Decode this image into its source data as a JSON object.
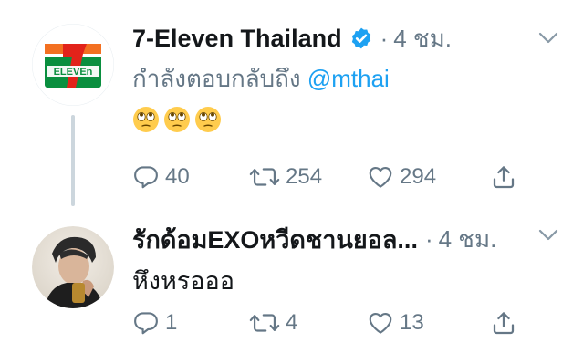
{
  "tweets": [
    {
      "display_name": "7-Eleven Thailand",
      "verified": true,
      "time": "4 ชม.",
      "reply_prefix": "กำลังตอบกลับถึง",
      "reply_to": "@mthai",
      "text": "",
      "emojis": [
        "face-with-rolling-eyes",
        "face-with-rolling-eyes",
        "face-with-rolling-eyes"
      ],
      "reply_count": "40",
      "retweet_count": "254",
      "like_count": "294",
      "avatar": "7-eleven-logo",
      "logo_text": "ELEVEn",
      "logo_number": "7"
    },
    {
      "display_name": "รักด้อมEXOหวีดชานยอล...",
      "verified": false,
      "time": "4 ชม.",
      "text": "หึงหรอออ",
      "reply_count": "1",
      "retweet_count": "4",
      "like_count": "13",
      "avatar": "user-photo"
    }
  ],
  "colors": {
    "text": "#14171a",
    "secondary": "#657786",
    "link": "#1da1f2",
    "thread_line": "#ccd6dd",
    "seven_green": "#0a8f3f",
    "seven_orange": "#f37021",
    "seven_red": "#e2231a"
  },
  "icons": {
    "reply": "reply-icon",
    "retweet": "retweet-icon",
    "like": "heart-icon",
    "share": "share-icon",
    "more": "chevron-down-icon",
    "verified": "verified-badge-icon"
  }
}
